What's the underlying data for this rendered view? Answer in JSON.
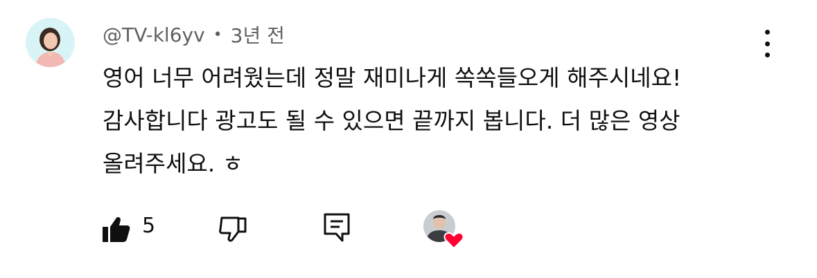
{
  "comment": {
    "author": "@TV-kl6yv",
    "separator": "•",
    "time": "3년 전",
    "text": "영어 너무 어려웠는데 정말 재미나게 쏙쏙들오게 해주시네요! 감사합니다 광고도 될 수 있으면 끝까지 봅니다. 더 많은 영상 올려주세요. ㅎ",
    "like_count": "5"
  },
  "icons": {
    "avatar": "user-avatar",
    "more": "more-vertical-icon",
    "like": "thumb-up-icon",
    "dislike": "thumb-down-icon",
    "reply": "reply-comment-icon",
    "creator_heart": "creator-heart-icon"
  },
  "colors": {
    "meta_text": "#606060",
    "heart": "#ff0033",
    "avatar_bg": "#d9f4f6"
  }
}
